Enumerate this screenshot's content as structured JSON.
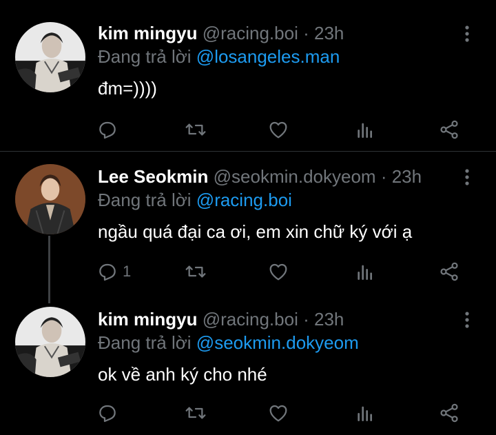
{
  "colors": {
    "background": "#000000",
    "text": "#ffffff",
    "muted": "#71767b",
    "mention": "#1d9bf0",
    "divider": "#2f3336"
  },
  "tweets": [
    {
      "name": "kim mingyu",
      "handle": "@racing.boi",
      "sep": "·",
      "time": "23h",
      "replying_prefix": "Đang trả lời",
      "replying_to": "@losangeles.man",
      "text": "đm=))))",
      "reply_count": "",
      "icons": [
        "reply-icon",
        "retweet-icon",
        "like-icon",
        "analytics-icon",
        "share-icon"
      ]
    },
    {
      "name": "Lee Seokmin",
      "handle": "@seokmin.dokyeom",
      "sep": "·",
      "time": "23h",
      "replying_prefix": "Đang trả lời",
      "replying_to": "@racing.boi",
      "text": "ngầu quá đại ca ơi, em xin chữ ký với ạ",
      "reply_count": "1",
      "icons": [
        "reply-icon",
        "retweet-icon",
        "like-icon",
        "analytics-icon",
        "share-icon"
      ]
    },
    {
      "name": "kim mingyu",
      "handle": "@racing.boi",
      "sep": "·",
      "time": "23h",
      "replying_prefix": "Đang trả lời",
      "replying_to": "@seokmin.dokyeom",
      "text": "ok về anh ký cho nhé",
      "reply_count": "",
      "icons": [
        "reply-icon",
        "retweet-icon",
        "like-icon",
        "analytics-icon",
        "share-icon"
      ]
    }
  ]
}
